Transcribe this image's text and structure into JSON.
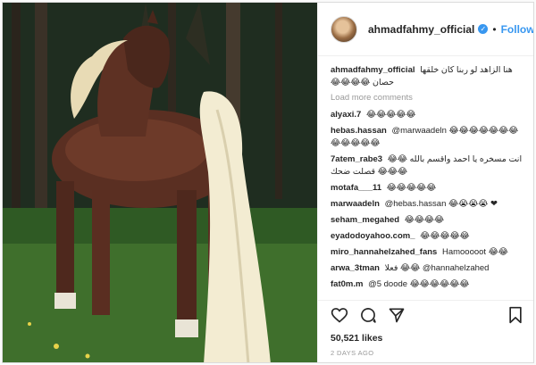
{
  "post": {
    "username": "ahmadfahmy_official",
    "verified_icon": "verified-badge-icon",
    "separator": "•",
    "follow_label": "Follow"
  },
  "caption": {
    "user": "ahmadfahmy_official",
    "text": "هنا الزاهد لو ربنا كان خلقها حصان 😂😂😂😂"
  },
  "load_more_label": "Load more comments",
  "comments": [
    {
      "user": "alyaxi.7",
      "text": "😂😂😂😂😂"
    },
    {
      "user": "hebas.hassan",
      "text": "@marwaadeln 😂😂😂😂😂😂😂😂😂😂😂😂"
    },
    {
      "user": "7atem_rabe3",
      "text": "انت مسخره يا احمد واقسم بالله 😂😂😂😂😂 قصلت ضحك"
    },
    {
      "user": "motafa___11",
      "text": "😂😂😂😂😂"
    },
    {
      "user": "marwaadeln",
      "text": "@hebas.hassan 😂😭😭😭 ❤"
    },
    {
      "user": "seham_megahed",
      "text": "😂😂😂😂"
    },
    {
      "user": "eyadodoyahoo.com_",
      "text": "😂😂😂😂😂"
    },
    {
      "user": "miro_hannahelzahed_fans",
      "text": "Hamooooot 😂😂"
    },
    {
      "user": "arwa_3tman",
      "text": "فعلا 😂😂 @hannahelzahed"
    },
    {
      "user": "fat0m.m",
      "text": "@5 doode 😂😂😂😂😂😂"
    }
  ],
  "actions": {
    "like_icon": "heart-icon",
    "comment_icon": "comment-icon",
    "share_icon": "share-icon",
    "save_icon": "bookmark-icon"
  },
  "likes_text": "50,521 likes",
  "time_ago": "2 DAYS AGO",
  "colors": {
    "link_blue": "#3897f0",
    "muted_gray": "#999999",
    "border": "#efefef"
  }
}
